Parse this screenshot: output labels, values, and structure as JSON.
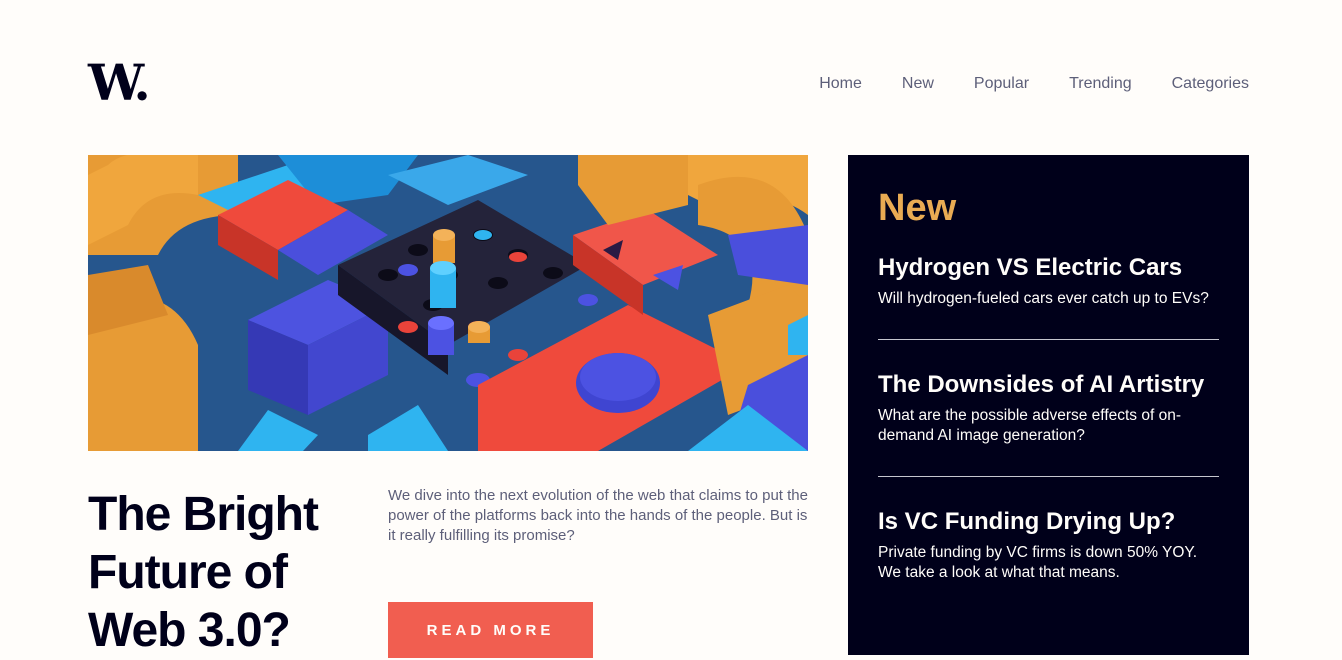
{
  "brand": {
    "logo_text": "W."
  },
  "nav": {
    "items": [
      {
        "label": "Home"
      },
      {
        "label": "New"
      },
      {
        "label": "Popular"
      },
      {
        "label": "Trending"
      },
      {
        "label": "Categories"
      }
    ]
  },
  "hero": {
    "image_icon": "abstract-3d-blocks-image",
    "headline": "The Bright Future of Web 3.0?",
    "description": "We dive into the next evolution of the web that claims to put the power of the platforms back into the hands of the people. But is it really fulfilling its promise?",
    "cta_label": "Read more"
  },
  "new_panel": {
    "title": "New",
    "items": [
      {
        "title": "Hydrogen VS Electric Cars",
        "summary": "Will hydrogen-fueled cars ever catch up to EVs?"
      },
      {
        "title": "The Downsides of AI Artistry",
        "summary": "What are the possible adverse effects of on-demand AI image generation?"
      },
      {
        "title": "Is VC Funding Drying Up?",
        "summary": "Private funding by VC firms is down 50% YOY. We take a look at what that means."
      }
    ]
  },
  "colors": {
    "background": "#fffdfa",
    "dark": "#00001a",
    "accent_orange": "#e9ab53",
    "accent_red": "#f15e50",
    "text_muted": "#5d5f79"
  }
}
